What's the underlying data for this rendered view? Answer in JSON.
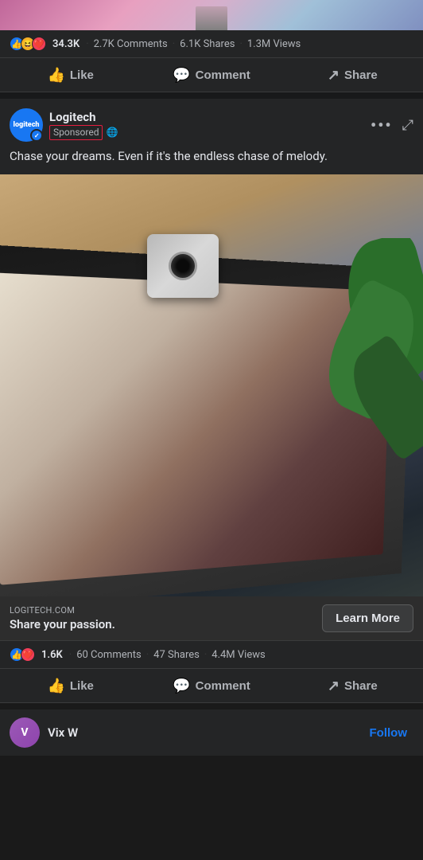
{
  "top_image": {
    "alt": "decorative top image"
  },
  "first_post": {
    "stats": {
      "reactions_count": "34.3K",
      "comments": "2.7K Comments",
      "shares": "6.1K Shares",
      "views": "1.3M Views"
    },
    "actions": {
      "like": "Like",
      "comment": "Comment",
      "share": "Share"
    }
  },
  "ad_post": {
    "author": "Logitech",
    "sponsored_label": "Sponsored",
    "more_icon": "•••",
    "expand_icon": "⤢",
    "globe_icon": "🌐",
    "post_text": "Chase your dreams. Even if it's the endless chase of melody.",
    "image_alt": "Logitech webcam on laptop",
    "cta": {
      "url": "LOGITECH.COM",
      "tagline": "Share your passion.",
      "learn_more": "Learn More"
    },
    "stats": {
      "reactions_count": "1.6K",
      "comments": "60 Comments",
      "shares": "47 Shares",
      "views": "4.4M Views"
    },
    "actions": {
      "like": "Like",
      "comment": "Comment",
      "share": "Share"
    }
  },
  "follow_section": {
    "name": "Vix W",
    "follow_label": "Follow",
    "avatar_initial": "V"
  }
}
